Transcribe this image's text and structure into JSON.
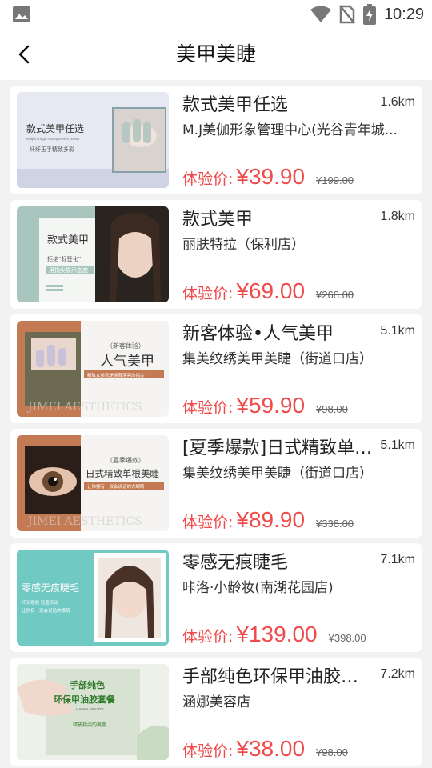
{
  "status_bar": {
    "time": "10:29",
    "icons": [
      "image-icon",
      "wifi-icon",
      "no-sim-icon",
      "battery-charging-icon"
    ]
  },
  "header": {
    "title": "美甲美睫",
    "back_icon": "chevron-left-icon"
  },
  "price_label": "体验价:",
  "items": [
    {
      "title": "款式美甲任选",
      "distance": "1.6km",
      "shop": "M.J美伽形象管理中心(光谷青年城...",
      "price": "¥39.90",
      "original_price": "¥199.00",
      "thumb_text": [
        "款式美甲任选",
        "Meijia image management center",
        "纤纤玉手精致多彩"
      ]
    },
    {
      "title": "款式美甲",
      "distance": "1.8km",
      "shop": "丽肤特拉（保利店）",
      "price": "¥69.00",
      "original_price": "¥268.00",
      "thumb_text": [
        "款式美甲",
        "拒绝“标签化”",
        "用指尖展示态度"
      ]
    },
    {
      "title": "新客体验•人气美甲",
      "distance": "5.1km",
      "shop": "集美纹绣美甲美睫（街道口店）",
      "price": "¥59.90",
      "original_price": "¥98.00",
      "thumb_text": [
        "（新客体验）",
        "人气美甲",
        "精致女孩就是拥有漂亮的指尖",
        "JIMEI AESTHETICS"
      ]
    },
    {
      "title": "[夏季爆款]日式精致单根美睫",
      "distance": "5.1km",
      "shop": "集美纹绣美甲美睫（街道口店）",
      "price": "¥89.90",
      "original_price": "¥338.00",
      "thumb_text": [
        "（夏季爆款）",
        "日式精致单根美睫",
        "让你拥有一双会说话的大眼睛",
        "JIMEI AESTHETICS"
      ]
    },
    {
      "title": "零感无痕睫毛",
      "distance": "7.1km",
      "shop": "咔洛·小龄妆(南湖花园店)",
      "price": "¥139.00",
      "original_price": "¥398.00",
      "thumb_text": [
        "零感无痕睫毛",
        "纤长卷翘 轻盈灵动",
        "让你有一双会说话的眼睛"
      ]
    },
    {
      "title": "手部纯色环保甲油胶套餐",
      "distance": "7.2km",
      "shop": "涵娜美容店",
      "price": "¥38.00",
      "original_price": "¥98.00",
      "thumb_text": [
        "手部纯色",
        "环保甲油胶套餐",
        "HANNA BEAUTY",
        "释放指尖的美丽"
      ]
    }
  ]
}
